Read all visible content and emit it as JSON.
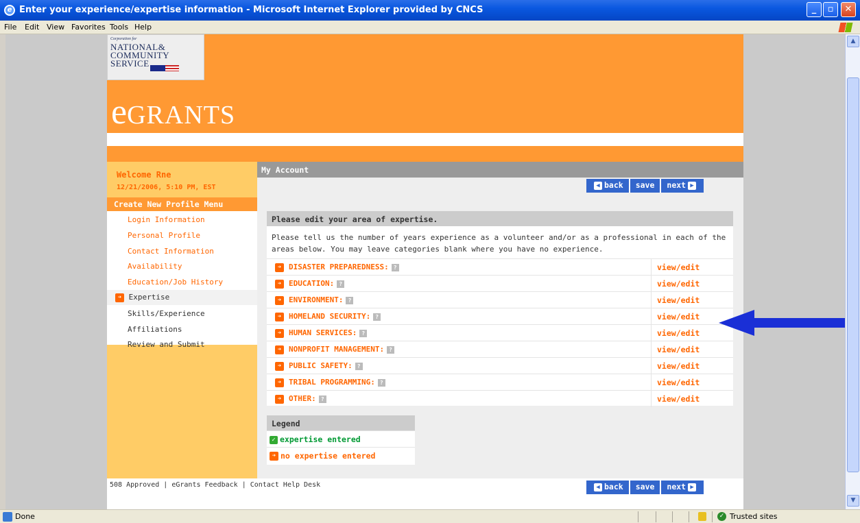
{
  "window": {
    "title": "Enter your experience/expertise information - Microsoft Internet Explorer provided by CNCS"
  },
  "menu": [
    "File",
    "Edit",
    "View",
    "Favorites",
    "Tools",
    "Help"
  ],
  "logo": {
    "small": "Corporation for",
    "line1": "NATIONAL&",
    "line2": "COMMUNITY",
    "line3": "SERVICE"
  },
  "brand": {
    "e": "e",
    "rest": "GRANTS"
  },
  "sidebar": {
    "welcome": "Welcome Rne",
    "datetime": "12/21/2006, 5:10 PM, EST",
    "menu_title": "Create New Profile Menu",
    "items": [
      "Login Information",
      "Personal Profile",
      "Contact Information",
      "Availability",
      "Education/Job History",
      "Expertise",
      "Skills/Experience",
      "Affiliations",
      "Review and Submit"
    ]
  },
  "main": {
    "section_title": "My Account",
    "buttons": {
      "back": "back",
      "save": "save",
      "next": "next"
    },
    "panel_title": "Please edit your area of expertise.",
    "intro": "Please tell us the number of years experience as a volunteer and/or as a professional in each of the areas below. You may leave categories blank where you have no experience.",
    "view_edit": "view/edit",
    "categories": [
      "DISASTER PREPAREDNESS:",
      "EDUCATION:",
      "ENVIRONMENT:",
      "HOMELAND SECURITY:",
      "HUMAN SERVICES:",
      "NONPROFIT MANAGEMENT:",
      "PUBLIC SAFETY:",
      "TRIBAL PROGRAMMING:",
      "OTHER:"
    ],
    "legend": {
      "title": "Legend",
      "entered": "expertise entered",
      "not_entered": "no expertise entered"
    }
  },
  "footer": {
    "links": [
      "508 Approved",
      "eGrants Feedback",
      "Contact Help Desk"
    ],
    "separator": "|"
  },
  "status": {
    "left": "Done",
    "zone": "Trusted sites"
  },
  "colors": {
    "orange": "#ff9933",
    "link_orange": "#ff6600",
    "button_blue": "#3366cc",
    "sidebar": "#ffcc66",
    "annotation_arrow": "#1a2fd6"
  }
}
